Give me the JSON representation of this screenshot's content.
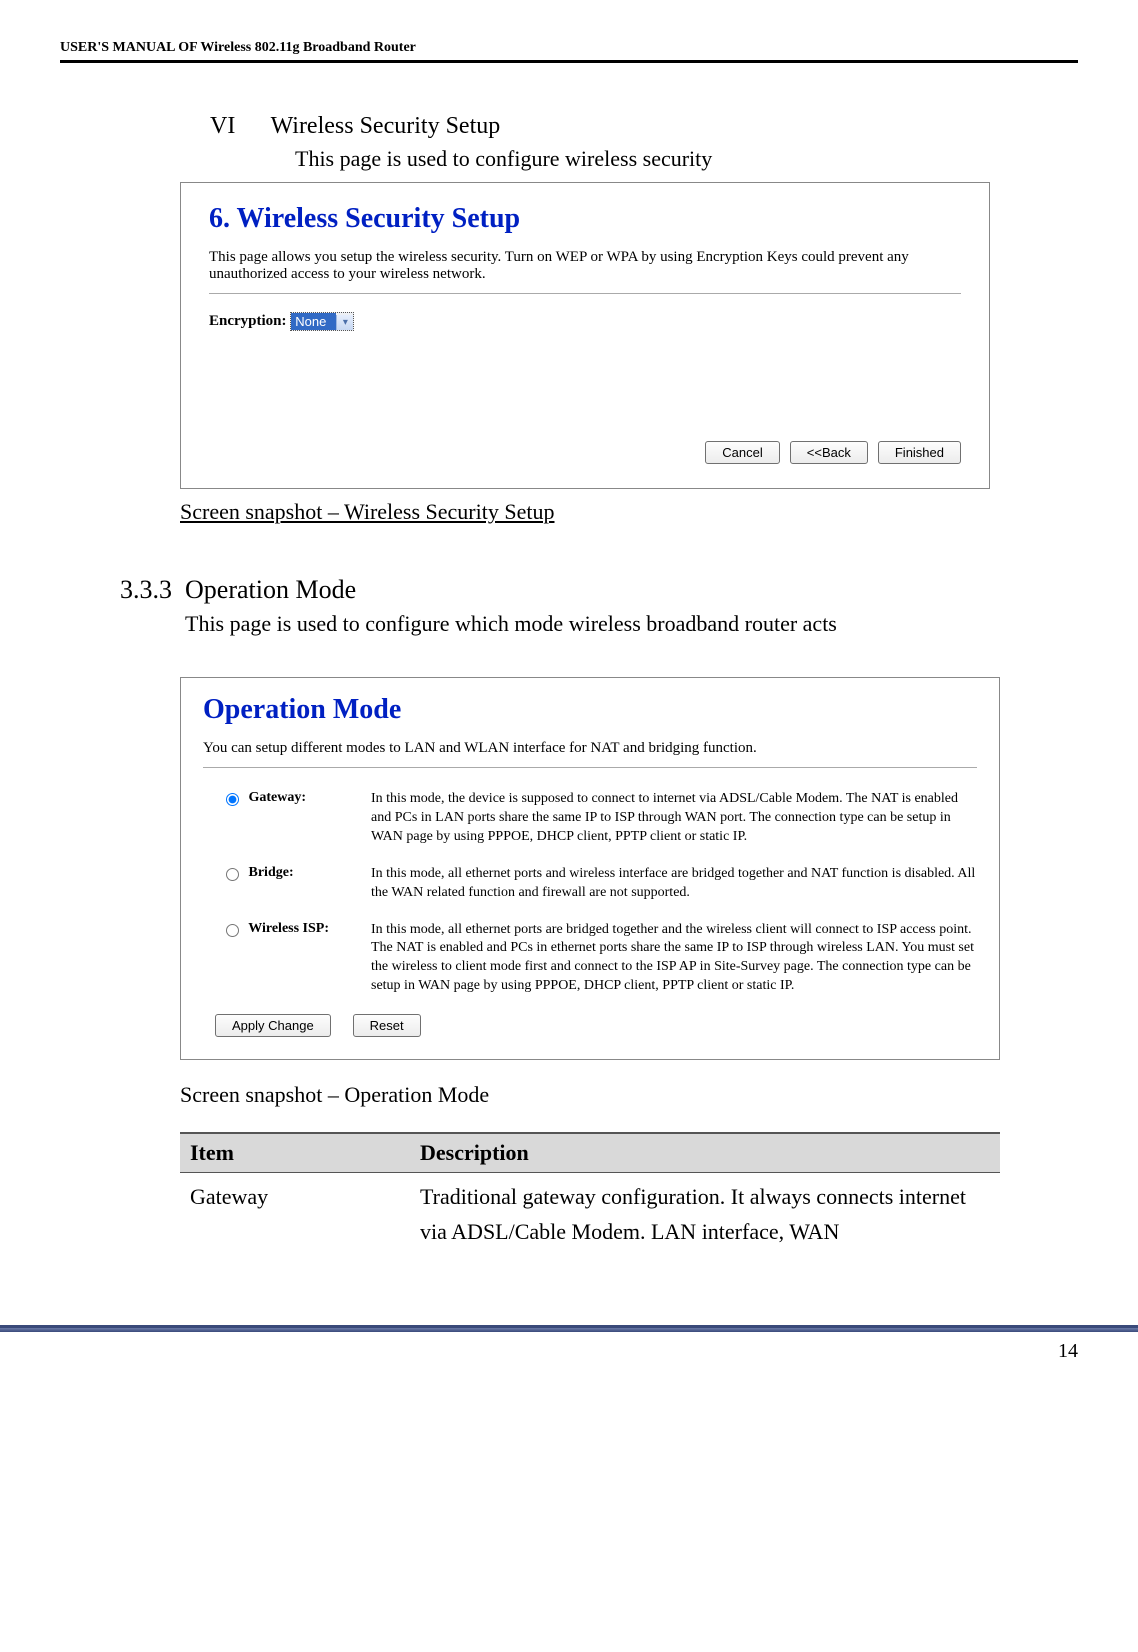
{
  "header": {
    "running": "USER'S MANUAL OF Wireless 802.11g Broadband Router"
  },
  "sectionVI": {
    "num": "VI",
    "title": "Wireless Security Setup",
    "intro": "This page is used to configure wireless security"
  },
  "panel6": {
    "title": "6. Wireless Security Setup",
    "desc": "This page allows you setup the wireless security. Turn on WEP or WPA by using Encryption Keys could prevent any unauthorized access to your wireless network.",
    "enc_label": "Encryption:",
    "enc_value": "None",
    "btn_cancel": "Cancel",
    "btn_back": "<<Back",
    "btn_finished": "Finished"
  },
  "caption1": "Screen snapshot – Wireless Security Setup",
  "section333": {
    "num": "3.3.3",
    "title": "Operation Mode",
    "intro": "This page is used to configure which mode wireless broadband router acts"
  },
  "opPanel": {
    "title": "Operation Mode",
    "desc": "You can setup different modes to LAN and WLAN interface for NAT and bridging function.",
    "rows": [
      {
        "label": "Gateway:",
        "text": "In this mode, the device is supposed to connect to internet via ADSL/Cable Modem. The NAT is enabled and PCs in LAN ports share the same IP to ISP through WAN port. The connection type can be setup in WAN page by using PPPOE, DHCP client, PPTP client or static IP."
      },
      {
        "label": "Bridge:",
        "text": "In this mode, all ethernet ports and wireless interface are bridged together and NAT function is disabled. All the WAN related function and firewall are not supported."
      },
      {
        "label": "Wireless ISP:",
        "text": "In this mode, all ethernet ports are bridged together and the wireless client will connect to ISP access point. The NAT is enabled and PCs in ethernet ports share the same IP to ISP through wireless LAN. You must set the wireless to client mode first and connect to the ISP AP in Site-Survey page. The connection type can be setup in WAN page by using PPPOE, DHCP client, PPTP client or static IP."
      }
    ],
    "btn_apply": "Apply Change",
    "btn_reset": "Reset"
  },
  "caption2": "Screen snapshot – Operation Mode",
  "table": {
    "h_item": "Item",
    "h_desc": "Description",
    "row1_item": "Gateway",
    "row1_desc": "Traditional gateway configuration. It always connects internet via ADSL/Cable Modem. LAN interface, WAN"
  },
  "page_num": "14"
}
